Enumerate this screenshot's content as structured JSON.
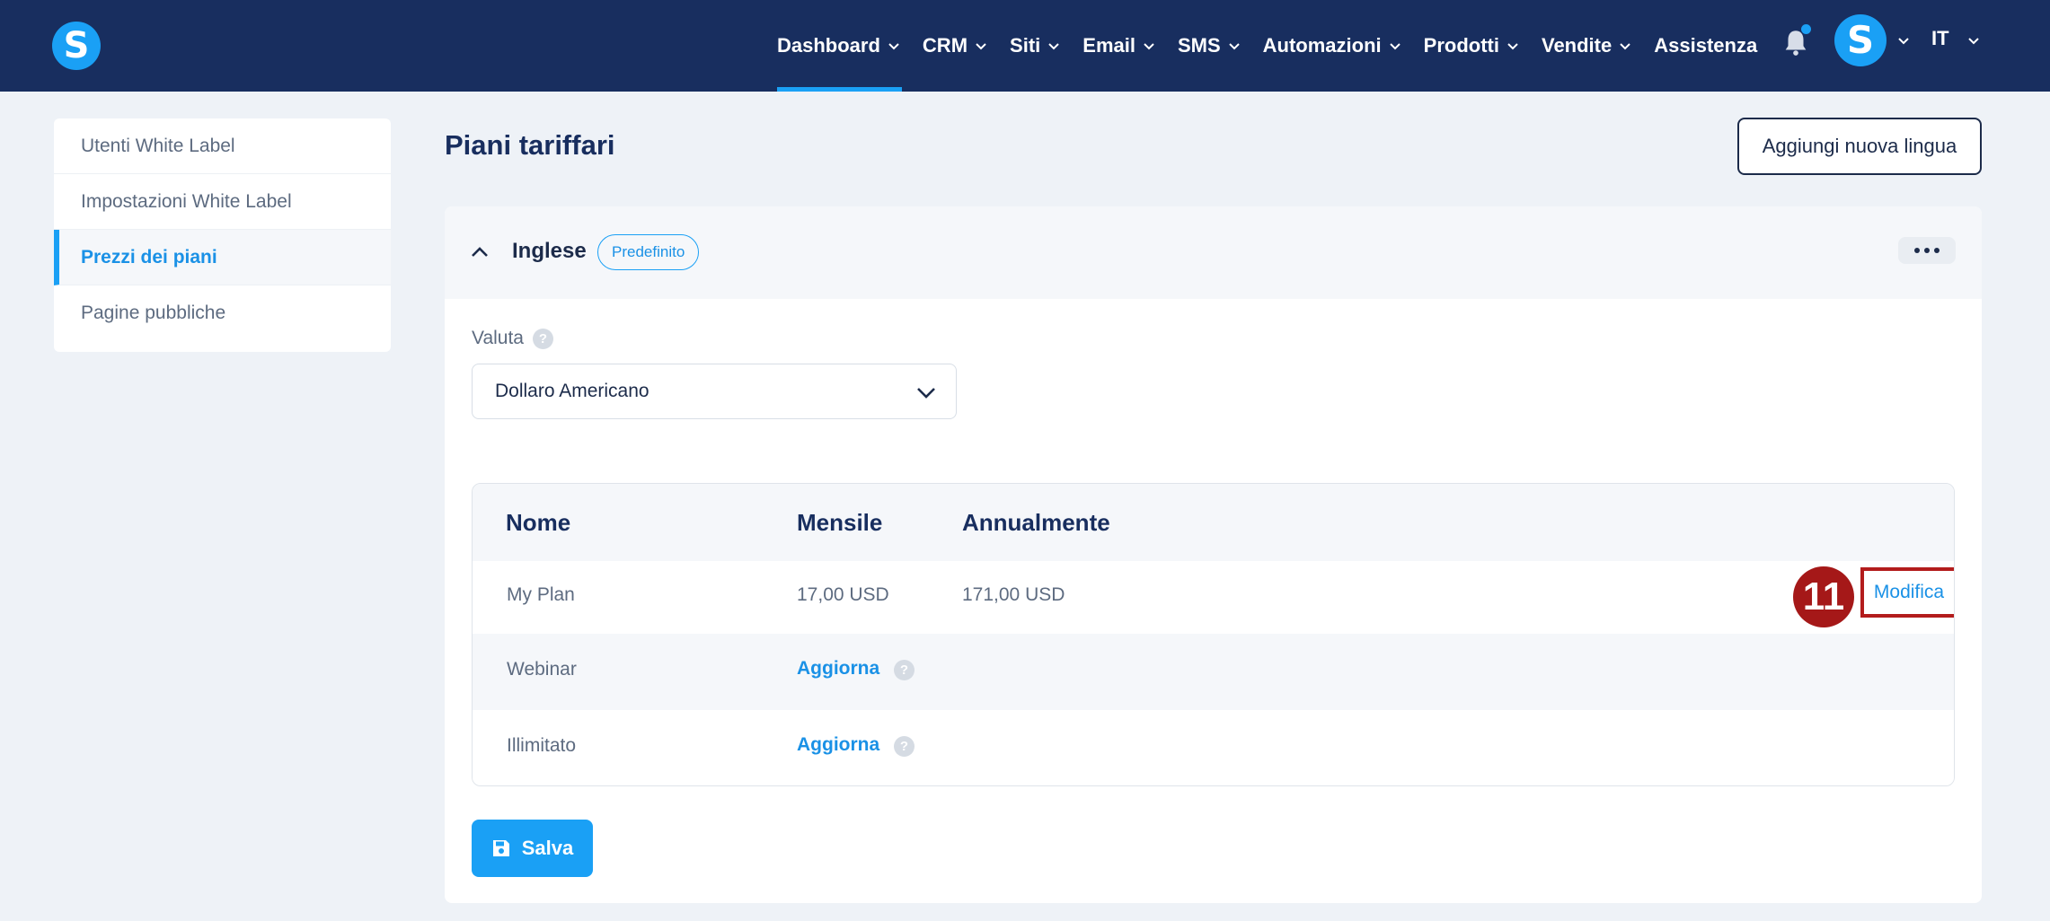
{
  "brand": {
    "logo_letter": "S",
    "accent": "#1aa0f5",
    "navy": "#182e5f"
  },
  "nav": {
    "items": [
      {
        "label": "Dashboard",
        "has_dropdown": true,
        "active": true
      },
      {
        "label": "CRM",
        "has_dropdown": true
      },
      {
        "label": "Siti",
        "has_dropdown": true
      },
      {
        "label": "Email",
        "has_dropdown": true
      },
      {
        "label": "SMS",
        "has_dropdown": true
      },
      {
        "label": "Automazioni",
        "has_dropdown": true
      },
      {
        "label": "Prodotti",
        "has_dropdown": true
      },
      {
        "label": "Vendite",
        "has_dropdown": true
      },
      {
        "label": "Assistenza",
        "has_dropdown": false
      }
    ],
    "avatar_letter": "S",
    "language": "IT"
  },
  "sidebar": {
    "items": [
      {
        "label": "Utenti White Label"
      },
      {
        "label": "Impostazioni White Label"
      },
      {
        "label": "Prezzi dei piani",
        "active": true
      },
      {
        "label": "Pagine pubbliche"
      }
    ]
  },
  "main": {
    "title": "Piani tariffari",
    "add_language_button": "Aggiungi nuova lingua",
    "language_section": {
      "name": "Inglese",
      "badge": "Predefinito",
      "currency_label": "Valuta",
      "help_glyph": "?",
      "currency_value": "Dollaro Americano",
      "table": {
        "headers": [
          "Nome",
          "Mensile",
          "Annualmente"
        ],
        "rows": [
          {
            "name": "My Plan",
            "monthly": "17,00 USD",
            "annual": "171,00 USD",
            "action": "Modifica"
          },
          {
            "name": "Webinar",
            "upgrade": "Aggiorna"
          },
          {
            "name": "Illimitato",
            "upgrade": "Aggiorna"
          }
        ]
      },
      "save_button": "Salva"
    },
    "step_marker": "11"
  }
}
